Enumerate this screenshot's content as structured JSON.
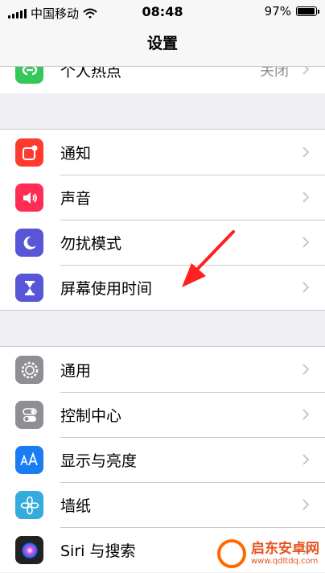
{
  "status_bar": {
    "carrier": "中国移动",
    "time": "08:48",
    "battery": "97%",
    "battery_level": 0.97
  },
  "nav": {
    "title": "设置"
  },
  "hotspot": {
    "label": "个人热点",
    "value": "关闭",
    "icon": "hotspot-icon",
    "color": "#34c759"
  },
  "group_a": [
    {
      "label": "通知",
      "icon": "notifications-icon",
      "color": "#ff3b30"
    },
    {
      "label": "声音",
      "icon": "sounds-icon",
      "color": "#ff2d55"
    },
    {
      "label": "勿扰模式",
      "icon": "do-not-disturb-icon",
      "color": "#5856d6"
    },
    {
      "label": "屏幕使用时间",
      "icon": "screen-time-icon",
      "color": "#5856d6"
    }
  ],
  "group_b": [
    {
      "label": "通用",
      "icon": "general-icon",
      "color": "#8e8e93"
    },
    {
      "label": "控制中心",
      "icon": "control-center-icon",
      "color": "#8e8e93"
    },
    {
      "label": "显示与亮度",
      "icon": "display-brightness-icon",
      "color": "#1a7cf2"
    },
    {
      "label": "墙纸",
      "icon": "wallpaper-icon",
      "color": "#35aadc"
    },
    {
      "label": "Siri 与搜索",
      "icon": "siri-icon",
      "color": "#222222"
    }
  ],
  "watermark": {
    "title": "启东安卓网",
    "url": "www.qdltdq.com"
  }
}
